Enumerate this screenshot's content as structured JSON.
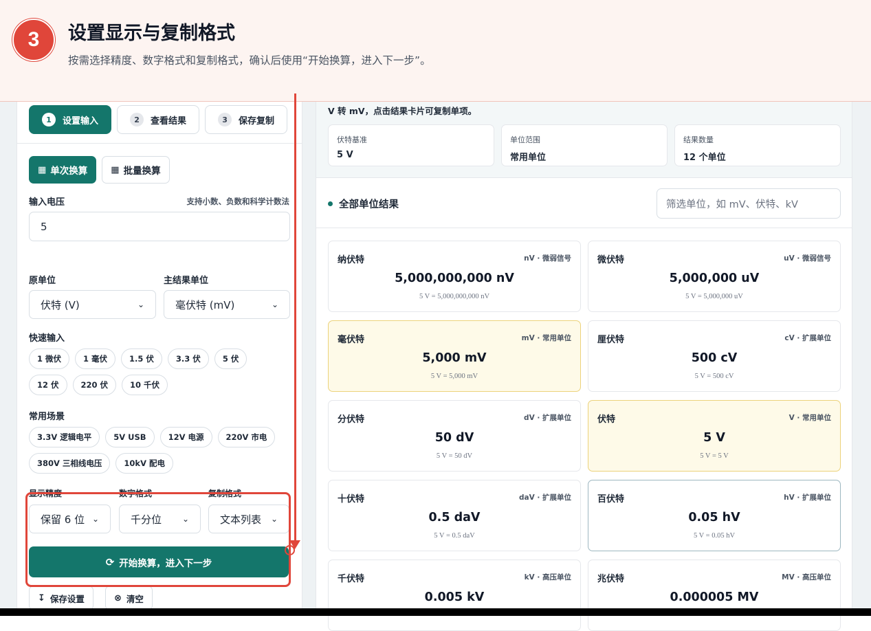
{
  "banner": {
    "step": "3",
    "title": "设置显示与复制格式",
    "subtitle": "按需选择精度、数字格式和复制格式，确认后使用“开始换算，进入下一步”。"
  },
  "tabs": [
    {
      "num": "1",
      "label": "设置输入"
    },
    {
      "num": "2",
      "label": "查看结果"
    },
    {
      "num": "3",
      "label": "保存复制"
    }
  ],
  "modes": {
    "single": "单次换算",
    "batch": "批量换算"
  },
  "input": {
    "label": "输入电压",
    "hint": "支持小数、负数和科学计数法",
    "value": "5"
  },
  "source_unit": {
    "label": "原单位",
    "value": "伏特 (V)"
  },
  "main_unit": {
    "label": "主结果单位",
    "value": "毫伏特 (mV)"
  },
  "quick": {
    "label": "快速输入",
    "items": [
      "1 微伏",
      "1 毫伏",
      "1.5 伏",
      "3.3 伏",
      "5 伏",
      "12 伏",
      "220 伏",
      "10 千伏"
    ]
  },
  "scenes": {
    "label": "常用场景",
    "items": [
      "3.3V 逻辑电平",
      "5V USB",
      "12V 电源",
      "220V 市电",
      "380V 三相线电压",
      "10kV 配电"
    ]
  },
  "precision": {
    "label": "显示精度",
    "value": "保留 6 位"
  },
  "number_format": {
    "label": "数字格式",
    "value": "千分位"
  },
  "copy_format": {
    "label": "复制格式",
    "value": "文本列表"
  },
  "actions": {
    "start": "开始换算，进入下一步",
    "save": "保存设置",
    "clear": "清空"
  },
  "results": {
    "note": "V 转 mV，点击结果卡片可复制单项。",
    "stats": [
      {
        "k": "伏特基准",
        "v": "5 V"
      },
      {
        "k": "单位范围",
        "v": "常用单位"
      },
      {
        "k": "结果数量",
        "v": "12 个单位"
      }
    ],
    "title": "全部单位结果",
    "filter_placeholder": "筛选单位，如 mV、伏特、kV",
    "cards": [
      {
        "name": "纳伏特",
        "tag": "nV · 微弱信号",
        "val": "5,000,000,000 nV",
        "eq": "5 V = 5,000,000,000 nV"
      },
      {
        "name": "微伏特",
        "tag": "uV · 微弱信号",
        "val": "5,000,000 uV",
        "eq": "5 V = 5,000,000 uV"
      },
      {
        "name": "毫伏特",
        "tag": "mV · 常用单位",
        "val": "5,000 mV",
        "eq": "5 V = 5,000 mV"
      },
      {
        "name": "厘伏特",
        "tag": "cV · 扩展单位",
        "val": "500 cV",
        "eq": "5 V = 500 cV"
      },
      {
        "name": "分伏特",
        "tag": "dV · 扩展单位",
        "val": "50 dV",
        "eq": "5 V = 50 dV"
      },
      {
        "name": "伏特",
        "tag": "V · 常用单位",
        "val": "5 V",
        "eq": "5 V = 5 V"
      },
      {
        "name": "十伏特",
        "tag": "daV · 扩展单位",
        "val": "0.5 daV",
        "eq": "5 V = 0.5 daV"
      },
      {
        "name": "百伏特",
        "tag": "hV · 扩展单位",
        "val": "0.05 hV",
        "eq": "5 V = 0.05 hV"
      },
      {
        "name": "千伏特",
        "tag": "kV · 高压单位",
        "val": "0.005 kV",
        "eq": ""
      },
      {
        "name": "兆伏特",
        "tag": "MV · 高压单位",
        "val": "0.000005 MV",
        "eq": ""
      }
    ]
  },
  "colors": {
    "accent": "#14766b",
    "annotation": "#e0463a",
    "highlight": "#fefae8"
  }
}
